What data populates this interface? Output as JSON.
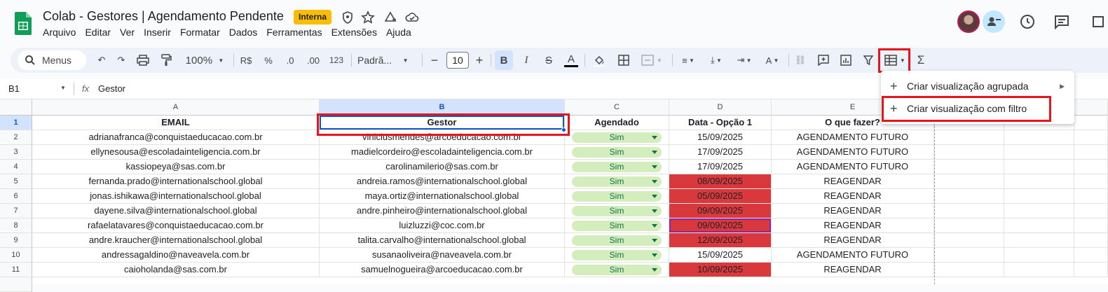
{
  "doc": {
    "title": "Colab - Gestores | Agendamento Pendente",
    "badge": "Interna"
  },
  "menubar": [
    "Arquivo",
    "Editar",
    "Ver",
    "Inserir",
    "Formatar",
    "Dados",
    "Ferramentas",
    "Extensões",
    "Ajuda"
  ],
  "toolbar": {
    "search_label": "Menus",
    "zoom": "100%",
    "currency": "R$",
    "percent": "%",
    "dec_less": ".0",
    "dec_more": ".00",
    "format_123": "123",
    "font": "Padrã...",
    "font_size": "10",
    "bold": "B",
    "italic": "I",
    "underline_a": "A"
  },
  "formula_bar": {
    "cell_ref": "B1",
    "fx": "fx",
    "value": "Gestor"
  },
  "columns": [
    "A",
    "B",
    "C",
    "D",
    "E"
  ],
  "rows": [
    {
      "n": "1",
      "email": "EMAIL",
      "gestor": "Gestor",
      "agendado": "Agendado",
      "data": "Data - Opção 1",
      "fazer": "O que fazer?",
      "header": true
    },
    {
      "n": "2",
      "email": "adrianafranca@conquistaeducacao.com.br",
      "gestor": "viniciusmendes@arcoeducacao.com.br",
      "agendado": "Sim",
      "data": "15/09/2025",
      "fazer": "AGENDAMENTO FUTURO",
      "red": false
    },
    {
      "n": "3",
      "email": "ellynesousa@escoladainteligencia.com.br",
      "gestor": "madielcordeiro@escoladainteligencia.com.br",
      "agendado": "Sim",
      "data": "17/09/2025",
      "fazer": "AGENDAMENTO FUTURO",
      "red": false
    },
    {
      "n": "4",
      "email": "kassiopeya@sas.com.br",
      "gestor": "carolinamilerio@sas.com.br",
      "agendado": "Sim",
      "data": "17/09/2025",
      "fazer": "AGENDAMENTO FUTURO",
      "red": false
    },
    {
      "n": "5",
      "email": "fernanda.prado@internationalschool.global",
      "gestor": "andreia.ramos@internationalschool.global",
      "agendado": "Sim",
      "data": "08/09/2025",
      "fazer": "REAGENDAR",
      "red": true
    },
    {
      "n": "6",
      "email": "jonas.ishikawa@internationalschool.global",
      "gestor": "maya.ortiz@internationalschool.global",
      "agendado": "Sim",
      "data": "05/09/2025",
      "fazer": "REAGENDAR",
      "red": true
    },
    {
      "n": "7",
      "email": "dayene.silva@internationalschool.global",
      "gestor": "andre.pinheiro@internationalschool.global",
      "agendado": "Sim",
      "data": "09/09/2025",
      "fazer": "REAGENDAR",
      "red": true
    },
    {
      "n": "8",
      "email": "rafaelatavares@conquistaeducacao.com.br",
      "gestor": "luizluzzi@coc.com.br",
      "agendado": "Sim",
      "data": "09/09/2025",
      "fazer": "REAGENDAR",
      "red": true
    },
    {
      "n": "9",
      "email": "andre.kraucher@internationalschool.global",
      "gestor": "talita.carvalho@internationalschool.global",
      "agendado": "Sim",
      "data": "12/09/2025",
      "fazer": "REAGENDAR",
      "red": true
    },
    {
      "n": "10",
      "email": "andressagaldino@naveavela.com.br",
      "gestor": "susanaoliveira@naveavela.com.br",
      "agendado": "Sim",
      "data": "15/09/2025",
      "fazer": "AGENDAMENTO FUTURO",
      "red": false
    },
    {
      "n": "11",
      "email": "caioholanda@sas.com.br",
      "gestor": "samuelnogueira@arcoeducacao.com.br",
      "agendado": "Sim",
      "data": "10/09/2025",
      "fazer": "REAGENDAR",
      "red": true
    }
  ],
  "dropdown_menu": {
    "items": [
      "Criar visualização agrupada",
      "Criar visualização com filtro"
    ]
  },
  "colors": {
    "accent": "#0b57d0",
    "highlight": "#e8141b",
    "chip_bg": "#d4edbc",
    "red_cell": "#d9383d",
    "badge": "#fbbc04"
  }
}
